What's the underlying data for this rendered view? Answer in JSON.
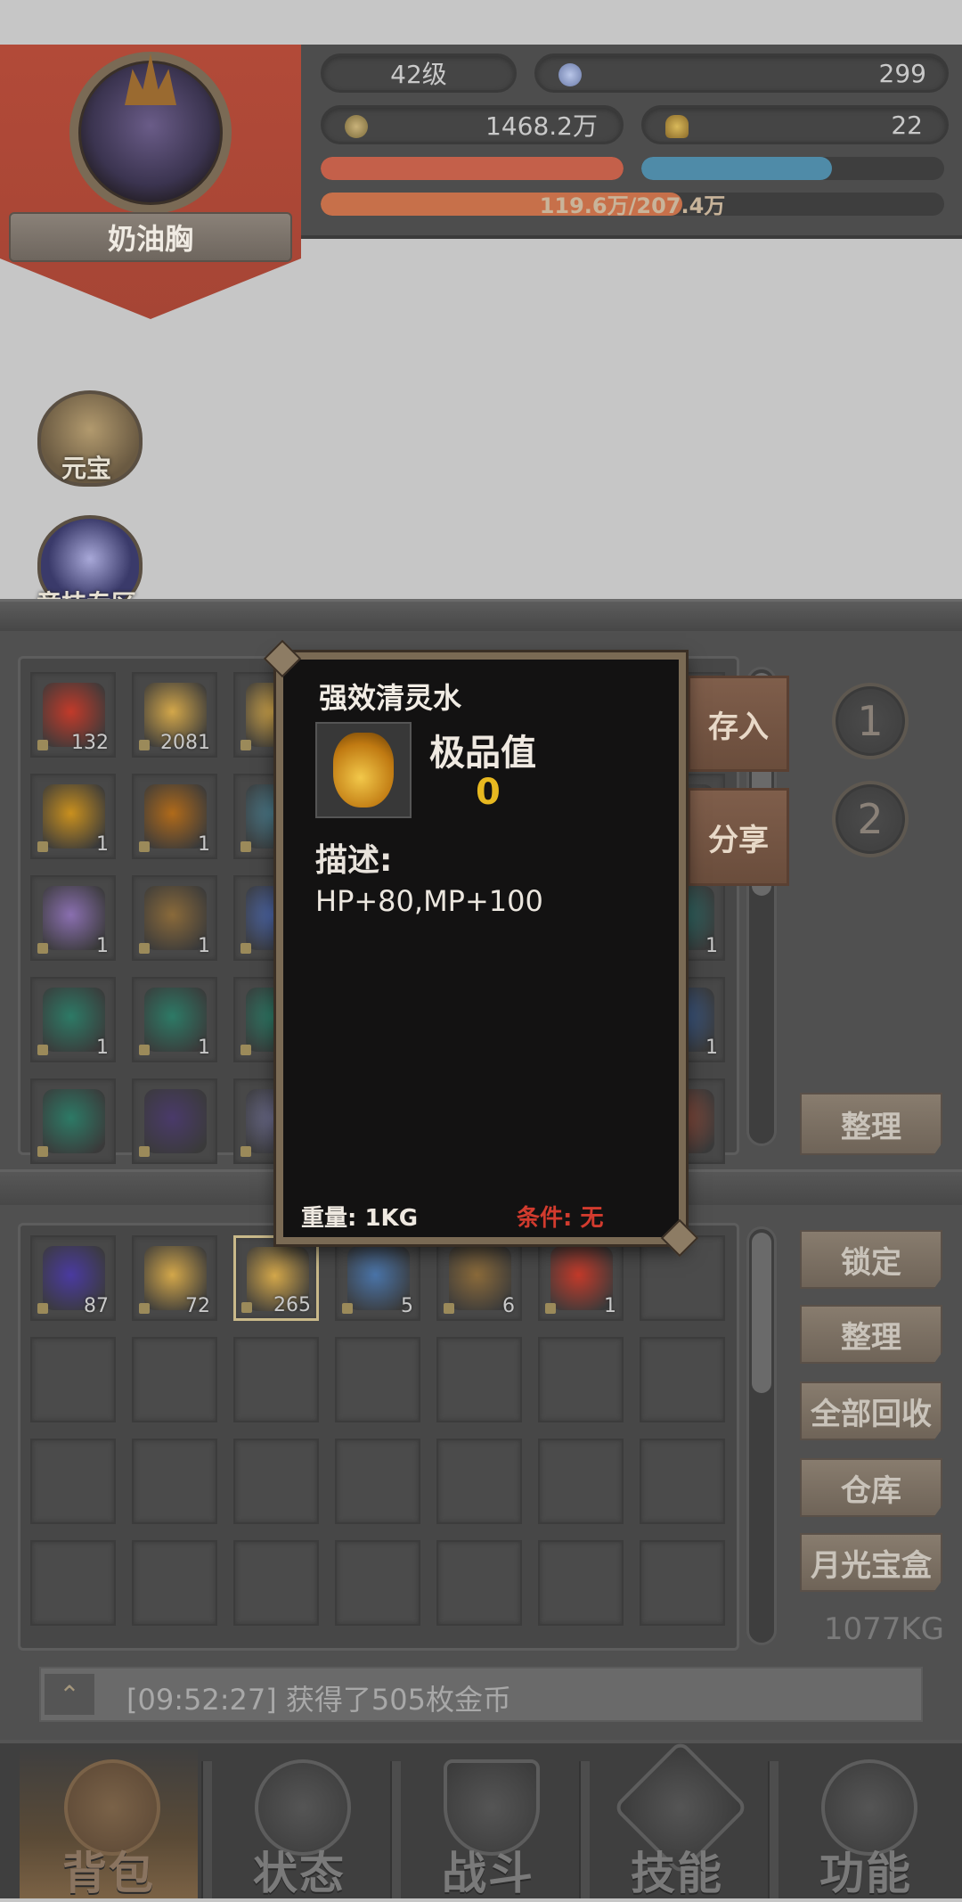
{
  "player": {
    "name": "奶油胸",
    "level": "42级",
    "gems": "299",
    "gold": "1468.2万",
    "ingots": "22",
    "hp_fill": 1.0,
    "mp_fill": 0.63,
    "exp_text": "119.6万/207.4万",
    "exp_fill": 0.58
  },
  "side_features": [
    {
      "label": "元宝"
    },
    {
      "label": "竞技专区"
    }
  ],
  "upper_grid": {
    "rows": [
      [
        {
          "qty": "132",
          "color": "#c23a2a"
        },
        {
          "qty": "2081",
          "color": "#d3a74a"
        },
        {
          "qty": "",
          "color": "#d3a74a"
        }
      ],
      [
        {
          "qty": "1",
          "color": "#c9901e"
        },
        {
          "qty": "1",
          "color": "#b06a1a"
        },
        {
          "qty": "",
          "color": "#4a7a8a"
        }
      ],
      [
        {
          "qty": "1",
          "color": "#8a6fb0"
        },
        {
          "qty": "1",
          "color": "#8a6a3a"
        },
        {
          "qty": "",
          "color": "#4c66a8"
        }
      ],
      [
        {
          "qty": "1",
          "color": "#2d7a66"
        },
        {
          "qty": "1",
          "color": "#2d7a66"
        },
        {
          "qty": "",
          "color": "#2d7a66"
        }
      ],
      [
        {
          "qty": "",
          "color": "#2d7a66"
        },
        {
          "qty": "",
          "color": "#4a3a6a"
        },
        {
          "qty": "",
          "color": "#6a6a8a"
        }
      ]
    ],
    "right_col": [
      {
        "qty": "",
        "color": "#5a5a5a"
      },
      {
        "qty": "",
        "color": "#5a5a5a"
      },
      {
        "qty": "1",
        "color": "#2d6a66"
      },
      {
        "qty": "1",
        "color": "#3a5a8a"
      },
      {
        "qty": "",
        "color": "#8a4a3a"
      }
    ]
  },
  "buttons": {
    "store": "存入",
    "share": "分享",
    "page1": "1",
    "page2": "2",
    "sort_upper": "整理",
    "lock": "锁定",
    "sort_lower": "整理",
    "recycle_all": "全部回收",
    "warehouse": "仓库",
    "moonlight_box": "月光宝盒"
  },
  "lower_grid": [
    {
      "qty": "87",
      "color": "#4a3aa0"
    },
    {
      "qty": "72",
      "color": "#d3a74a"
    },
    {
      "qty": "265",
      "color": "#d3a74a",
      "selected": true
    },
    {
      "qty": "5",
      "color": "#4a74a8"
    },
    {
      "qty": "6",
      "color": "#8a6a3a"
    },
    {
      "qty": "1",
      "color": "#c23a2a"
    }
  ],
  "total_weight": "1077KG",
  "log": {
    "message": "[09:52:27] 获得了505枚金币"
  },
  "tooltip": {
    "item_name": "强效清灵水",
    "grade_label": "极品值",
    "grade_value": "0",
    "desc_label": "描述:",
    "description": "HP+80,MP+100",
    "weight": "重量:  1KG",
    "condition": "条件:  无"
  },
  "nav": {
    "tabs": [
      "背包",
      "状态",
      "战斗",
      "技能",
      "功能"
    ],
    "active_index": 0
  },
  "colors": {
    "hp": "#c4604a",
    "mp": "#4f8ba8",
    "exp": "#c7704a",
    "accent_gold": "#e7b820",
    "condition_red": "#d23b2e"
  }
}
